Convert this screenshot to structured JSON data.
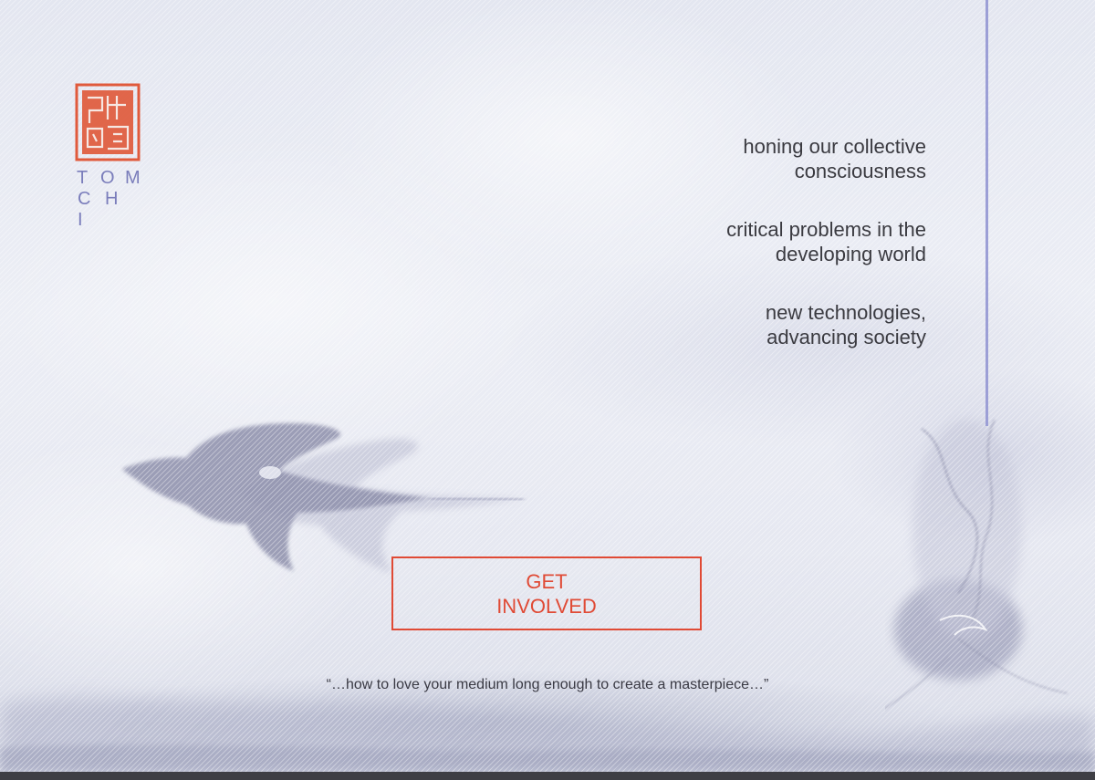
{
  "logo": {
    "seal_icon": "red-chinese-seal-icon",
    "seal_color": "#e05a3c",
    "wordmark_letters": {
      "row1": [
        "T",
        "O",
        "M"
      ],
      "row2": [
        "C",
        "H"
      ],
      "row3": [
        "I"
      ]
    },
    "wordmark_color": "#7a7dbb"
  },
  "taglines": [
    {
      "line1": "honing our collective",
      "line2": "consciousness"
    },
    {
      "line1": "critical problems in the",
      "line2": "developing world"
    },
    {
      "line1": "new technologies,",
      "line2": "advancing society"
    }
  ],
  "cta": {
    "label": "GET INVOLVED",
    "color": "#e04a35"
  },
  "quote": "“…how to love your medium long enough to create a masterpiece…”",
  "decor": {
    "bird_icon": "swallow-bird-icon",
    "flower_icon": "ink-flower-icon",
    "accent_line_color": "#9c9fd6"
  }
}
